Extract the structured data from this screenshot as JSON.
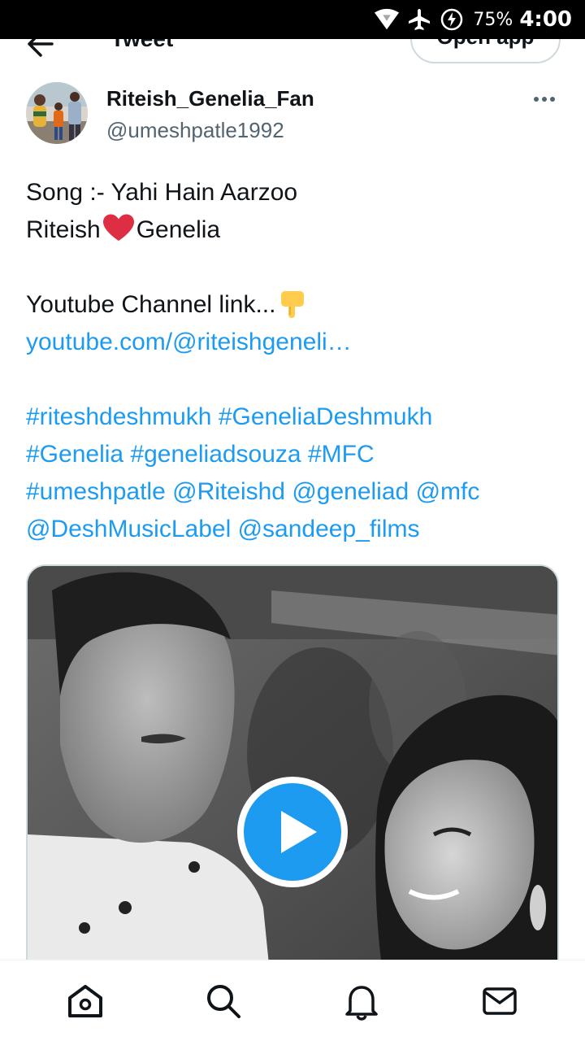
{
  "status_bar": {
    "battery_percent": "75%",
    "time": "4:00",
    "icons": [
      "wifi-icon",
      "airplane-mode-icon",
      "battery-saver-icon"
    ]
  },
  "header": {
    "title": "Tweet",
    "open_app_label": "Open app",
    "back_icon": "back-arrow-icon"
  },
  "tweet": {
    "author": {
      "display_name": "Riteish_Genelia_Fan",
      "handle": "@umeshpatle1992"
    },
    "more_icon": "more-options-icon",
    "lines": {
      "song": "Song :- Yahi Hain Aarzoo",
      "name_left": "Riteish",
      "name_right": "Genelia",
      "channel": "Youtube Channel link...",
      "url": "youtube.com/@riteishgeneli…",
      "tags": {
        "t1": "#riteshdeshmukh",
        "t2": "#GeneliaDeshmukh",
        "t3": "#Genelia",
        "t4": "#geneliadsouza",
        "t5": "#MFC",
        "t6": "#umeshpatle",
        "t7": "@Riteishd",
        "t8": "@geneliad",
        "t9": "@mfc",
        "t10": "@DeshMusicLabel",
        "t11": "@sandeep_films"
      }
    },
    "media": {
      "type": "video",
      "play_icon": "play-icon"
    }
  },
  "bottom_nav": {
    "items": [
      "home-icon",
      "search-icon",
      "notifications-icon",
      "messages-icon"
    ]
  },
  "colors": {
    "accent": "#1d9bf0",
    "text": "#0f1419",
    "secondary": "#536471"
  }
}
